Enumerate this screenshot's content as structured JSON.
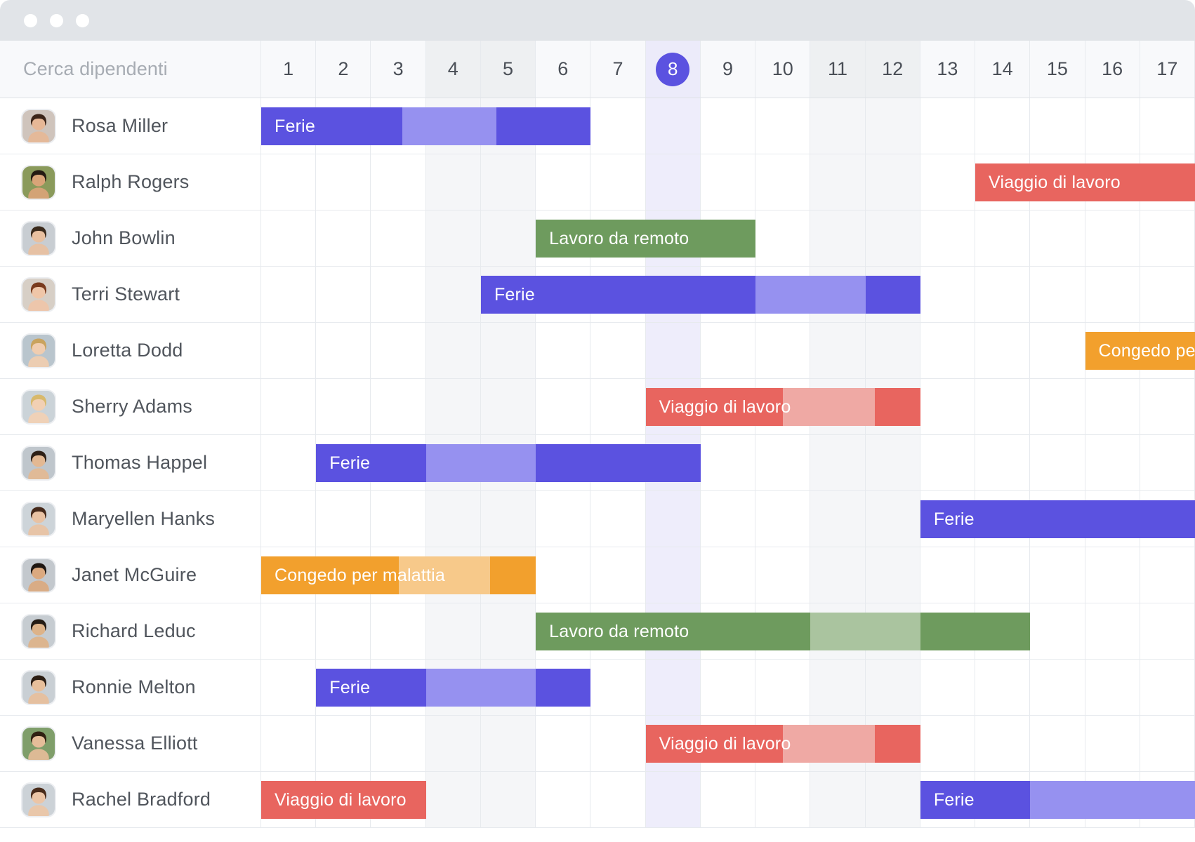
{
  "window": {
    "titlebar_buttons": [
      "close-dot",
      "minimize-dot",
      "maximize-dot"
    ]
  },
  "search": {
    "placeholder": "Cerca dipendenti",
    "value": ""
  },
  "calendar": {
    "days": [
      "1",
      "2",
      "3",
      "4",
      "5",
      "6",
      "7",
      "8",
      "9",
      "10",
      "11",
      "12",
      "13",
      "14",
      "15",
      "16",
      "17"
    ],
    "weekend_days": [
      "4",
      "5",
      "11",
      "12"
    ],
    "today": "8"
  },
  "colors": {
    "vacation": "#5b52e0",
    "vacation_light": "#9691f0",
    "business_trip": "#e8655f",
    "business_trip_light": "#efa9a4",
    "remote": "#6e9b5e",
    "remote_light": "#aac49f",
    "sick": "#f2a02d",
    "sick_light": "#f7c98a",
    "today_column": "#eeedfb",
    "weekend_column": "#f5f6f8",
    "titlebar": "#e1e4e8"
  },
  "legend_labels": {
    "vacation": "Ferie",
    "business_trip": "Viaggio di lavoro",
    "remote": "Lavoro da remoto",
    "sick": "Congedo per malattia"
  },
  "employees": [
    {
      "name": "Rosa Miller",
      "avatar_hair": "#3b2418",
      "avatar_skin": "#e6b796",
      "avatar_bg": "#cfc4bc",
      "bars": [
        {
          "label": "Ferie",
          "type": "vacation",
          "start": 1,
          "end": 7,
          "segments": [
            {
              "days": 3,
              "shade": "full"
            },
            {
              "days": 2,
              "shade": "light"
            },
            {
              "days": 2,
              "shade": "full"
            }
          ]
        }
      ]
    },
    {
      "name": "Ralph Rogers",
      "avatar_hair": "#241a12",
      "avatar_skin": "#d9a478",
      "avatar_bg": "#8a9a5b",
      "bars": [
        {
          "label": "Viaggio di lavoro",
          "type": "business_trip",
          "start": 14,
          "end": 18,
          "segments": [
            {
              "days": 4,
              "shade": "full"
            }
          ]
        }
      ]
    },
    {
      "name": "John Bowlin",
      "avatar_hair": "#3a2a1c",
      "avatar_skin": "#e8c0a0",
      "avatar_bg": "#c8cdd2",
      "bars": [
        {
          "label": "Lavoro da remoto",
          "type": "remote",
          "start": 6,
          "end": 10,
          "segments": [
            {
              "days": 4,
              "shade": "full"
            }
          ]
        }
      ]
    },
    {
      "name": "Terri Stewart",
      "avatar_hair": "#7a3b1e",
      "avatar_skin": "#efc6a8",
      "avatar_bg": "#d7cfc6",
      "bars": [
        {
          "label": "Ferie",
          "type": "vacation",
          "start": 5,
          "end": 13,
          "segments": [
            {
              "days": 5,
              "shade": "full"
            },
            {
              "days": 2,
              "shade": "light"
            },
            {
              "days": 1,
              "shade": "full"
            }
          ]
        }
      ]
    },
    {
      "name": "Loretta Dodd",
      "avatar_hair": "#c9a35e",
      "avatar_skin": "#f0cdb0",
      "avatar_bg": "#b9c5cd",
      "bars": [
        {
          "label": "Congedo per malattia",
          "type": "sick",
          "start": 16,
          "end": 18,
          "segments": [
            {
              "days": 2,
              "shade": "full"
            }
          ]
        }
      ]
    },
    {
      "name": "Sherry Adams",
      "avatar_hair": "#d8b96c",
      "avatar_skin": "#f2d0b4",
      "avatar_bg": "#cbd3d8",
      "bars": [
        {
          "label": "Viaggio di lavoro",
          "type": "business_trip",
          "start": 8,
          "end": 13,
          "segments": [
            {
              "days": 3,
              "shade": "full"
            },
            {
              "days": 2,
              "shade": "light"
            },
            {
              "days": 1,
              "shade": "full"
            }
          ]
        }
      ]
    },
    {
      "name": "Thomas Happel",
      "avatar_hair": "#2e2016",
      "avatar_skin": "#e3b892",
      "avatar_bg": "#bfc6cc",
      "bars": [
        {
          "label": "Ferie",
          "type": "vacation",
          "start": 2,
          "end": 9,
          "segments": [
            {
              "days": 2,
              "shade": "full"
            },
            {
              "days": 2,
              "shade": "light"
            },
            {
              "days": 3,
              "shade": "full"
            }
          ]
        }
      ]
    },
    {
      "name": "Maryellen Hanks",
      "avatar_hair": "#45291a",
      "avatar_skin": "#e9c2a3",
      "avatar_bg": "#cdd4d9",
      "bars": [
        {
          "label": "Ferie",
          "type": "vacation",
          "start": 13,
          "end": 18,
          "segments": [
            {
              "days": 5,
              "shade": "full"
            }
          ]
        }
      ]
    },
    {
      "name": "Janet McGuire",
      "avatar_hair": "#1f1712",
      "avatar_skin": "#dba97f",
      "avatar_bg": "#c3c8cd",
      "bars": [
        {
          "label": "Congedo per malattia",
          "type": "sick",
          "start": 1,
          "end": 6,
          "segments": [
            {
              "days": 3,
              "shade": "full"
            },
            {
              "days": 2,
              "shade": "light"
            },
            {
              "days": 1,
              "shade": "full"
            }
          ]
        }
      ]
    },
    {
      "name": "Richard Leduc",
      "avatar_hair": "#241c14",
      "avatar_skin": "#ddb389",
      "avatar_bg": "#c6ccd1",
      "bars": [
        {
          "label": "Lavoro da remoto",
          "type": "remote",
          "start": 6,
          "end": 15,
          "segments": [
            {
              "days": 5,
              "shade": "full"
            },
            {
              "days": 2,
              "shade": "light"
            },
            {
              "days": 2,
              "shade": "full"
            }
          ]
        }
      ]
    },
    {
      "name": "Ronnie Melton",
      "avatar_hair": "#2b1d13",
      "avatar_skin": "#e7bf9b",
      "avatar_bg": "#c9cfd4",
      "bars": [
        {
          "label": "Ferie",
          "type": "vacation",
          "start": 2,
          "end": 7,
          "segments": [
            {
              "days": 2,
              "shade": "full"
            },
            {
              "days": 2,
              "shade": "light"
            },
            {
              "days": 1,
              "shade": "full"
            }
          ]
        }
      ]
    },
    {
      "name": "Vanessa Elliott",
      "avatar_hair": "#302012",
      "avatar_skin": "#e5bd99",
      "avatar_bg": "#7f9e6a",
      "bars": [
        {
          "label": "Viaggio di lavoro",
          "type": "business_trip",
          "start": 8,
          "end": 13,
          "segments": [
            {
              "days": 3,
              "shade": "full"
            },
            {
              "days": 2,
              "shade": "light"
            },
            {
              "days": 1,
              "shade": "full"
            }
          ]
        }
      ]
    },
    {
      "name": "Rachel Bradford",
      "avatar_hair": "#4a2c1b",
      "avatar_skin": "#ecc5a6",
      "avatar_bg": "#ccd2d7",
      "bars": [
        {
          "label": "Viaggio di lavoro",
          "type": "business_trip",
          "start": 1,
          "end": 4,
          "segments": [
            {
              "days": 3,
              "shade": "full"
            }
          ]
        },
        {
          "label": "Ferie",
          "type": "vacation",
          "start": 13,
          "end": 18,
          "segments": [
            {
              "days": 2,
              "shade": "full"
            },
            {
              "days": 3,
              "shade": "light"
            }
          ]
        }
      ]
    }
  ]
}
